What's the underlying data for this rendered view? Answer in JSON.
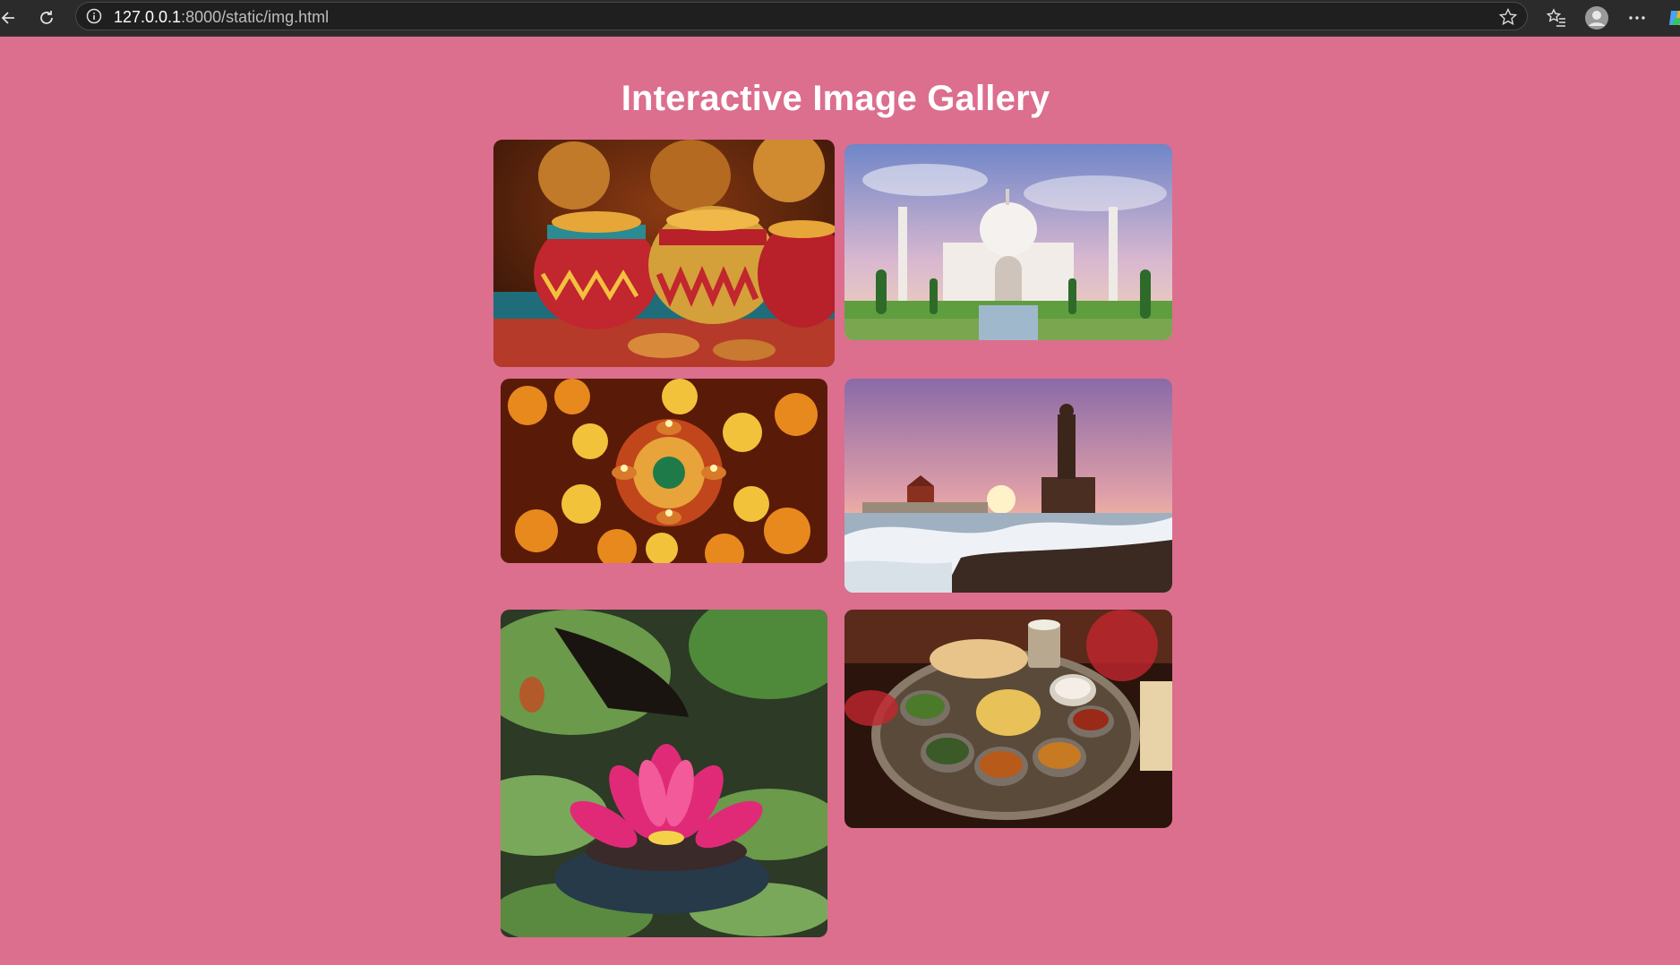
{
  "browser": {
    "url_host": "127.0.0.1",
    "url_rest": ":8000/static/img.html",
    "icons": [
      "back-icon",
      "reload-icon",
      "info-icon",
      "favorite-star-icon",
      "favorites-icon",
      "profile-icon",
      "more-icon",
      "copilot-icon"
    ]
  },
  "page": {
    "title": "Interactive Image Gallery",
    "background": "#dc6e8e"
  },
  "gallery": {
    "images": [
      {
        "subject": "painted clay pots"
      },
      {
        "subject": "Taj Mahal"
      },
      {
        "subject": "diyas and marigold rangoli"
      },
      {
        "subject": "Kanyakumari statue at sunset"
      },
      {
        "subject": "pink lotus"
      },
      {
        "subject": "thali meal"
      }
    ]
  }
}
